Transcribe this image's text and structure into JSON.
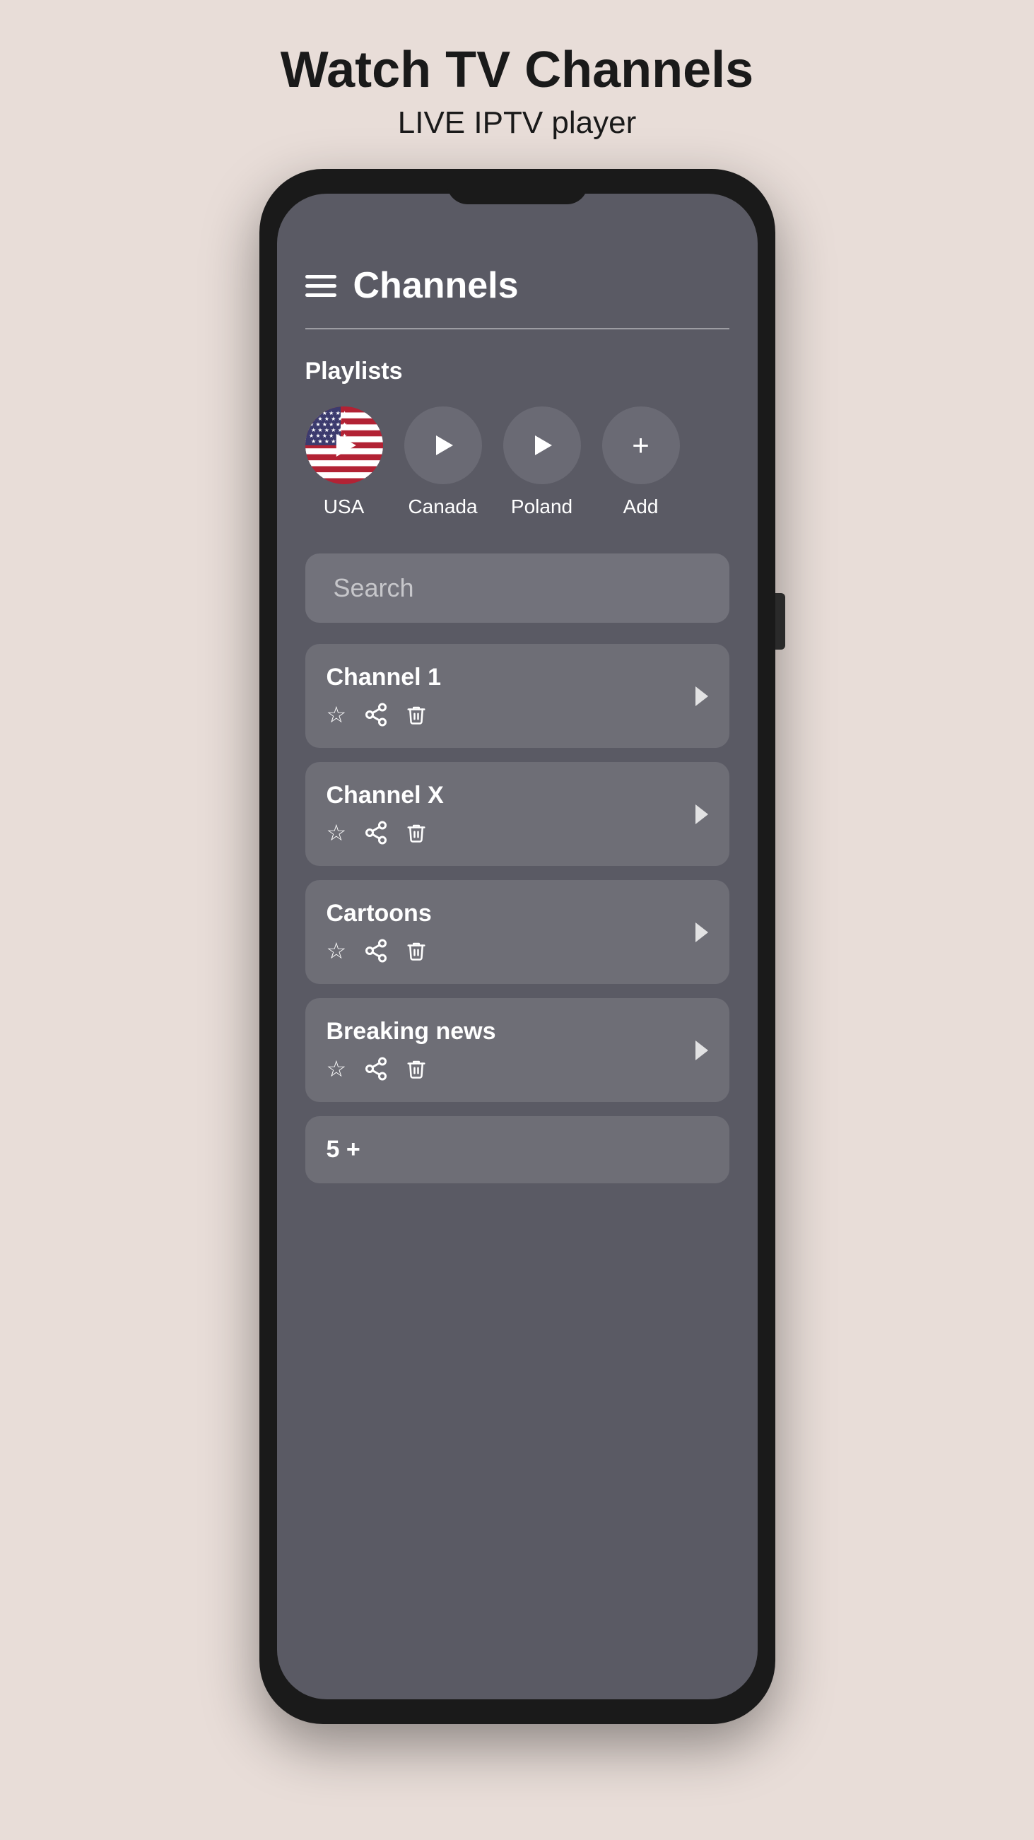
{
  "header": {
    "title": "Watch TV Channels",
    "subtitle": "LIVE IPTV player"
  },
  "app": {
    "screen_title": "Channels",
    "playlists_label": "Playlists",
    "playlists": [
      {
        "id": "usa",
        "label": "USA",
        "type": "flag"
      },
      {
        "id": "canada",
        "label": "Canada",
        "type": "play"
      },
      {
        "id": "poland",
        "label": "Poland",
        "type": "play"
      },
      {
        "id": "add",
        "label": "Add",
        "type": "plus"
      }
    ],
    "search_placeholder": "Search",
    "channels": [
      {
        "name": "Channel 1"
      },
      {
        "name": "Channel X"
      },
      {
        "name": "Cartoons"
      },
      {
        "name": "Breaking news"
      }
    ],
    "more_label": "5 +"
  }
}
